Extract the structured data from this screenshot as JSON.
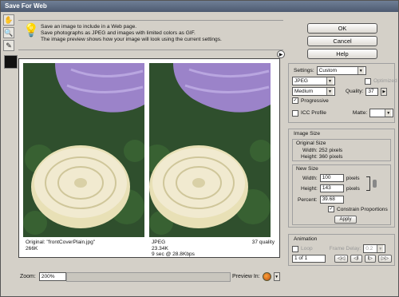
{
  "window": {
    "title": "Save For Web"
  },
  "info": {
    "lines": [
      "Save an image to include in a Web page.",
      "Save photographs as JPEG and images with limited colors as GIF.",
      "The image preview shows how your image will look using the current settings."
    ]
  },
  "buttons": {
    "ok": "OK",
    "cancel": "Cancel",
    "help": "Help"
  },
  "settings": {
    "label": "Settings:",
    "preset": "Custom",
    "format": "JPEG",
    "quality_level": "Medium",
    "optimized_label": "Optimized",
    "quality_label": "Quality:",
    "quality_value": "37",
    "progressive_label": "Progressive",
    "icc_label": "ICC Profile",
    "matte_label": "Matte:"
  },
  "image_size": {
    "title": "Image Size",
    "original_title": "Original Size",
    "original_width": "Width:  252 pixels",
    "original_height": "Height:  360 pixels",
    "new_title": "New Size",
    "width_label": "Width:",
    "width_value": "100",
    "height_label": "Height:",
    "height_value": "143",
    "percent_label": "Percent:",
    "percent_value": "39.68",
    "unit": "pixels",
    "constrain_label": "Constrain Proportions",
    "apply_label": "Apply"
  },
  "animation": {
    "title": "Animation",
    "loop_label": "Loop",
    "frame_delay_label": "Frame Delay:",
    "frame_delay_value": "0.2",
    "frame_counter": "1 of 1",
    "nav": [
      "◁◁",
      "◁I",
      "I▷",
      "▷▷"
    ]
  },
  "preview": {
    "original_caption": "Original: \"frontCoverPlain.jpg\"",
    "original_size": "266K",
    "optimized_format": "JPEG",
    "optimized_size": "23.34K",
    "optimized_time": "9 sec @ 28.8Kbps",
    "optimized_quality": "37 quality"
  },
  "zoom": {
    "label": "Zoom:",
    "value": "200%"
  },
  "preview_in": {
    "label": "Preview In:"
  },
  "icons": [
    "hand-icon",
    "zoom-icon",
    "eyedropper-icon",
    "lightbulb-icon",
    "browser-icon"
  ]
}
